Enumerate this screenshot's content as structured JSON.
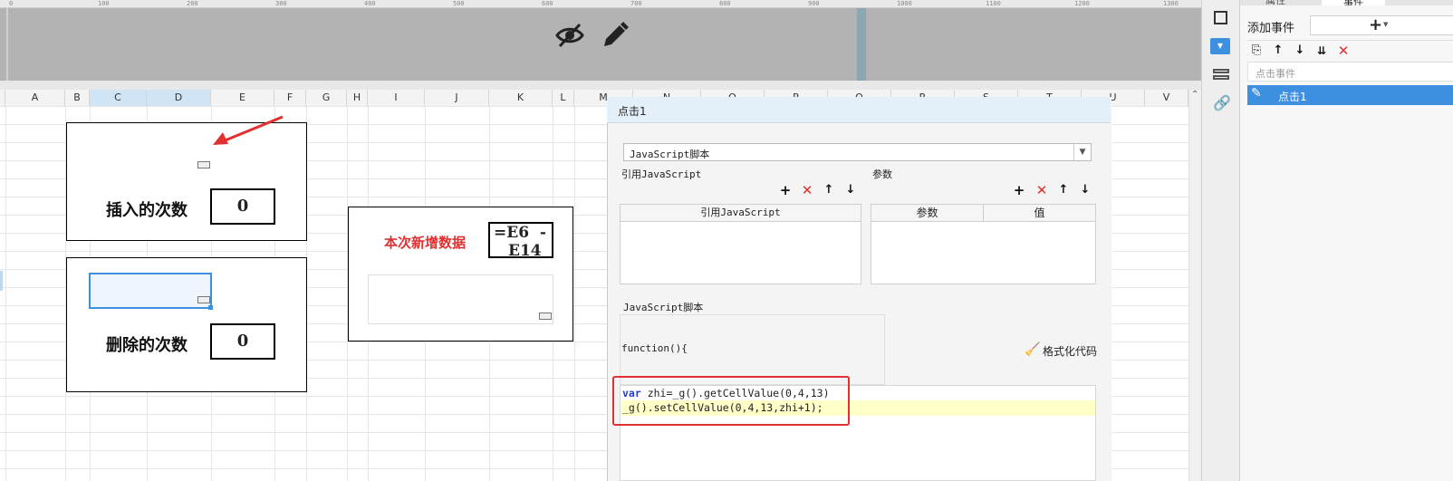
{
  "ruler": {
    "ticks": [
      "0",
      "100",
      "200",
      "300",
      "400",
      "500",
      "600",
      "700",
      "800",
      "900",
      "1000",
      "1100",
      "1200",
      "1300"
    ]
  },
  "toolbar": {
    "hide_icon": "eye-slash-icon",
    "edit_icon": "pencil-icon"
  },
  "columns": [
    "A",
    "B",
    "C",
    "D",
    "E",
    "F",
    "G",
    "H",
    "I",
    "J",
    "K",
    "L",
    "M",
    "N",
    "O",
    "P",
    "Q",
    "R",
    "S",
    "T",
    "U",
    "V"
  ],
  "sheet": {
    "insert_label": "插入的次数",
    "insert_value": "0",
    "delete_label": "删除的次数",
    "delete_value": "0",
    "new_data_label": "本次新增数据",
    "new_data_formula_line1": "=E6  -",
    "new_data_formula_line2": "E14"
  },
  "dialog": {
    "title": "点击1",
    "script_type": "JavaScript脚本",
    "ref_js_section": "引用JavaScript",
    "params_section": "参数",
    "ref_js_header": "引用JavaScript",
    "params_header_param": "参数",
    "params_header_value": "值",
    "js_script_section": "JavaScript脚本",
    "function_signature": "function(){",
    "format_code_label": "格式化代码",
    "code_line1_kw": "var",
    "code_line1_rest": " zhi=_g().getCellValue(0,4,13)",
    "code_line2": "_g().setCellValue(0,4,13,zhi+1);"
  },
  "right_panel": {
    "tab_left": "属性",
    "tab_mid": "事件",
    "add_event_label": "添加事件",
    "add_symbol": "+",
    "event_type_placeholder": "点击事件",
    "event_item": "点击1"
  },
  "colors": {
    "accent": "#3d8fe0",
    "red": "#e23030",
    "code_highlight": "#ffffc8"
  }
}
